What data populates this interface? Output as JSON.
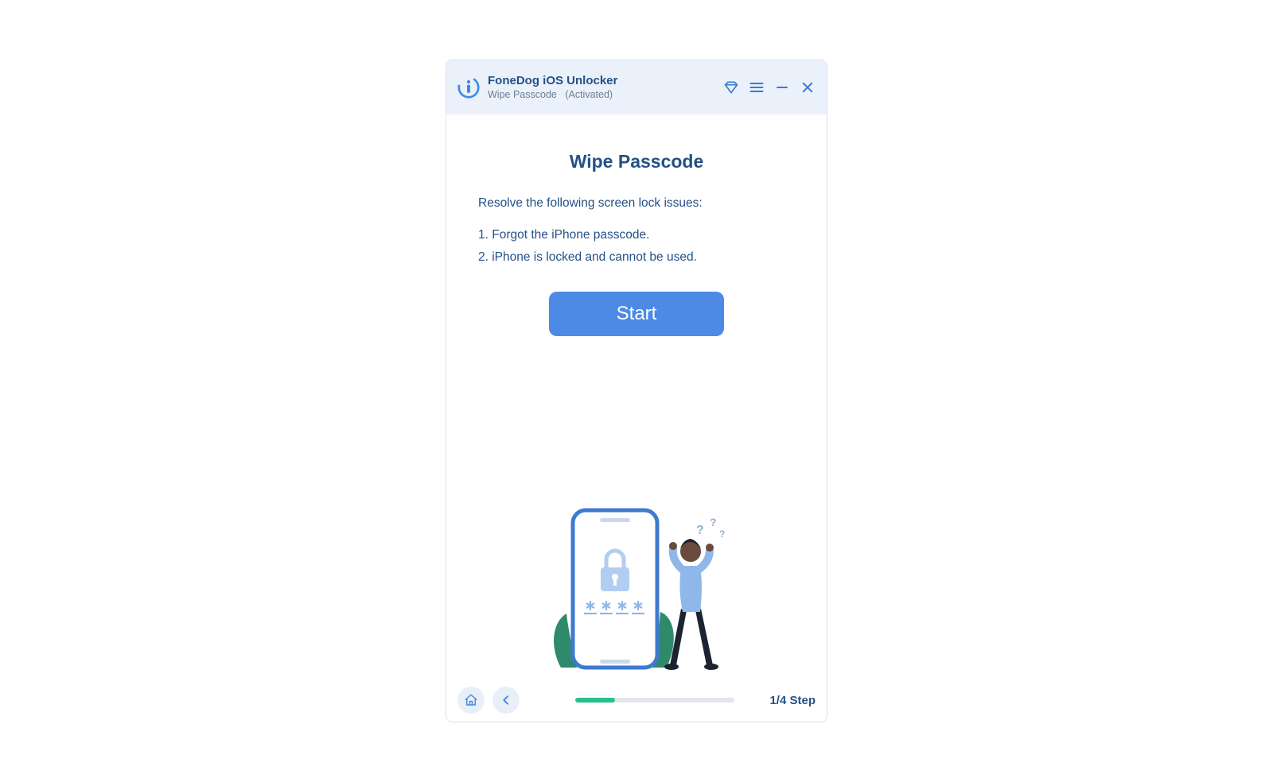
{
  "header": {
    "app_title": "FoneDog iOS Unlocker",
    "subtitle_mode": "Wipe Passcode",
    "subtitle_status": "(Activated)"
  },
  "page": {
    "title": "Wipe Passcode",
    "intro": "Resolve the following screen lock issues:",
    "issues": [
      "1. Forgot the iPhone passcode.",
      "2. iPhone is locked and cannot be used."
    ],
    "start_label": "Start"
  },
  "footer": {
    "step_label": "1/4 Step",
    "progress_percent": 25
  },
  "colors": {
    "accent": "#4c8ae6",
    "header_bg": "#eaf1fb",
    "text_dark": "#245186",
    "progress_green": "#27c08c"
  }
}
